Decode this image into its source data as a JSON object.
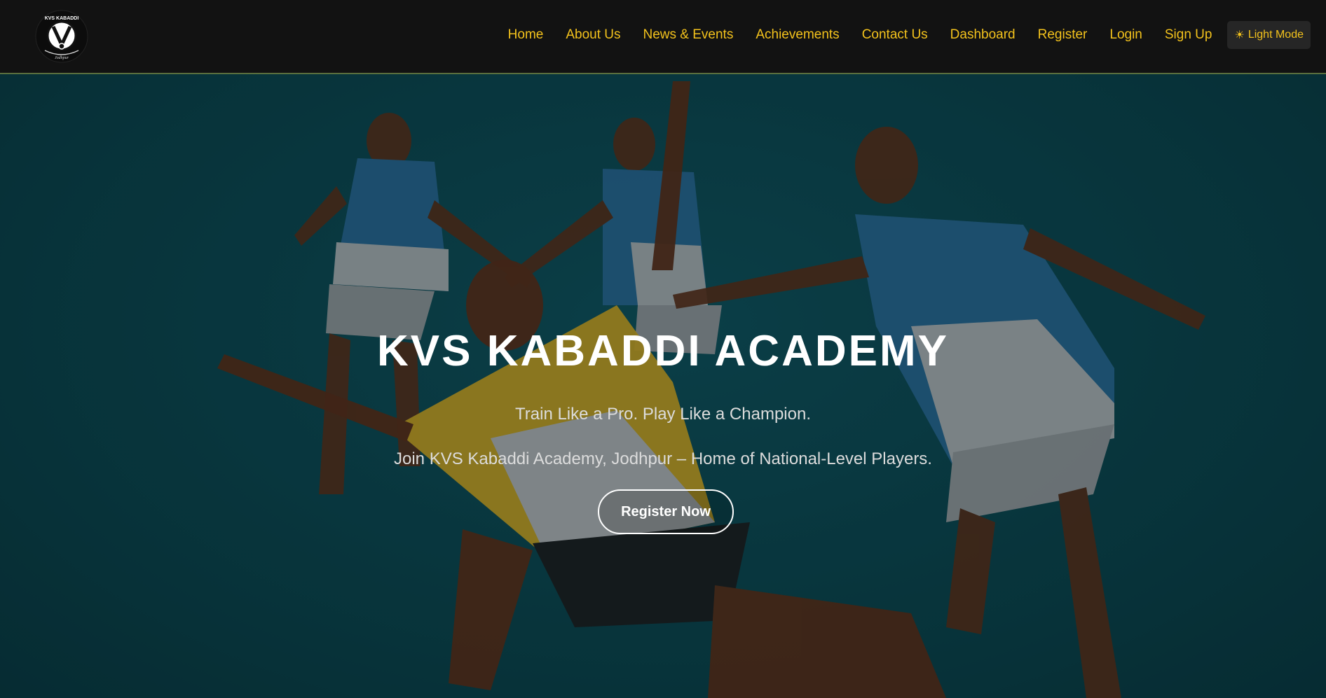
{
  "brand": {
    "logo_text": "KVS KABADDI",
    "logo_sub": "Jodhpur"
  },
  "nav": {
    "items": [
      {
        "label": "Home"
      },
      {
        "label": "About Us"
      },
      {
        "label": "News & Events"
      },
      {
        "label": "Achievements"
      },
      {
        "label": "Contact Us"
      },
      {
        "label": "Dashboard"
      },
      {
        "label": "Register"
      },
      {
        "label": "Login"
      },
      {
        "label": "Sign Up"
      }
    ],
    "theme_toggle": {
      "icon": "sun-icon",
      "label": "Light Mode"
    }
  },
  "hero": {
    "title": "KVS KABADDI ACADEMY",
    "tagline": "Train Like a Pro. Play Like a Champion.",
    "subtitle": "Join KVS Kabaddi Academy, Jodhpur – Home of National-Level Players.",
    "cta_label": "Register Now"
  },
  "colors": {
    "nav_bg": "#121212",
    "nav_text": "#f3c21c",
    "hero_bg": "#0d4a55",
    "jersey_blue": "#2a6f9e",
    "jersey_yellow": "#c9a92a",
    "cta_border": "#ffffff"
  }
}
